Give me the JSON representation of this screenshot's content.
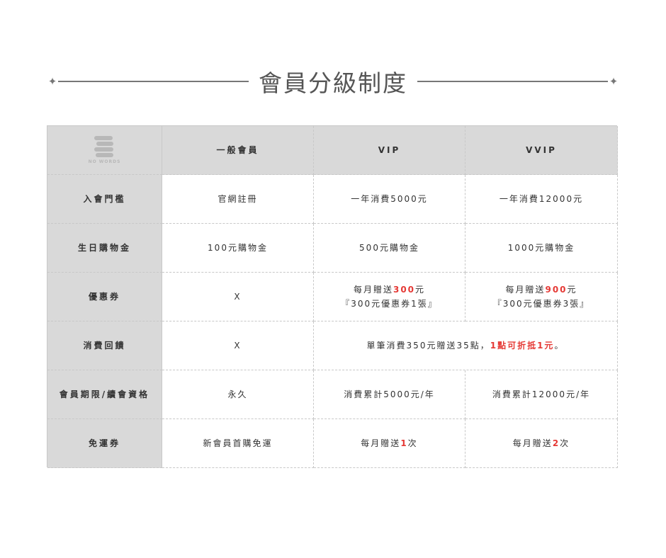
{
  "title": "會員分級制度",
  "logo": {
    "text": "NO WORDS",
    "color": "#b8b8b8"
  },
  "accent_red": "#e53935",
  "columns": [
    "一般會員",
    "VIP",
    "VVIP"
  ],
  "rows": [
    {
      "label": "入會門檻",
      "cells": [
        {
          "text": "官網註冊"
        },
        {
          "text": "一年消費5000元"
        },
        {
          "text": "一年消費12000元"
        }
      ]
    },
    {
      "label": "生日購物金",
      "cells": [
        {
          "text": "100元購物金"
        },
        {
          "text": "500元購物金"
        },
        {
          "text": "1000元購物金"
        }
      ]
    },
    {
      "label": "優惠券",
      "cells": [
        {
          "text": "X"
        },
        {
          "pre": "每月贈送",
          "highlight": "300",
          "post": "元",
          "line2": "『300元優惠券1張』"
        },
        {
          "pre": "每月贈送",
          "highlight": "900",
          "post": "元",
          "line2": "『300元優惠券3張』"
        }
      ]
    },
    {
      "label": "消費回饋",
      "cells": [
        {
          "text": "X"
        },
        {
          "pre": "單筆消費350元贈送35點，",
          "highlight": "1點可折抵1元",
          "post": "。"
        }
      ]
    },
    {
      "label": "會員期限/續會資格",
      "cells": [
        {
          "text": "永久"
        },
        {
          "text": "消費累計5000元/年"
        },
        {
          "text": "消費累計12000元/年"
        }
      ]
    },
    {
      "label": "免運券",
      "cells": [
        {
          "text": "新會員首購免運"
        },
        {
          "pre": "每月贈送",
          "highlight": "1",
          "post": "次"
        },
        {
          "pre": "每月贈送",
          "highlight": "2",
          "post": "次"
        }
      ]
    }
  ]
}
